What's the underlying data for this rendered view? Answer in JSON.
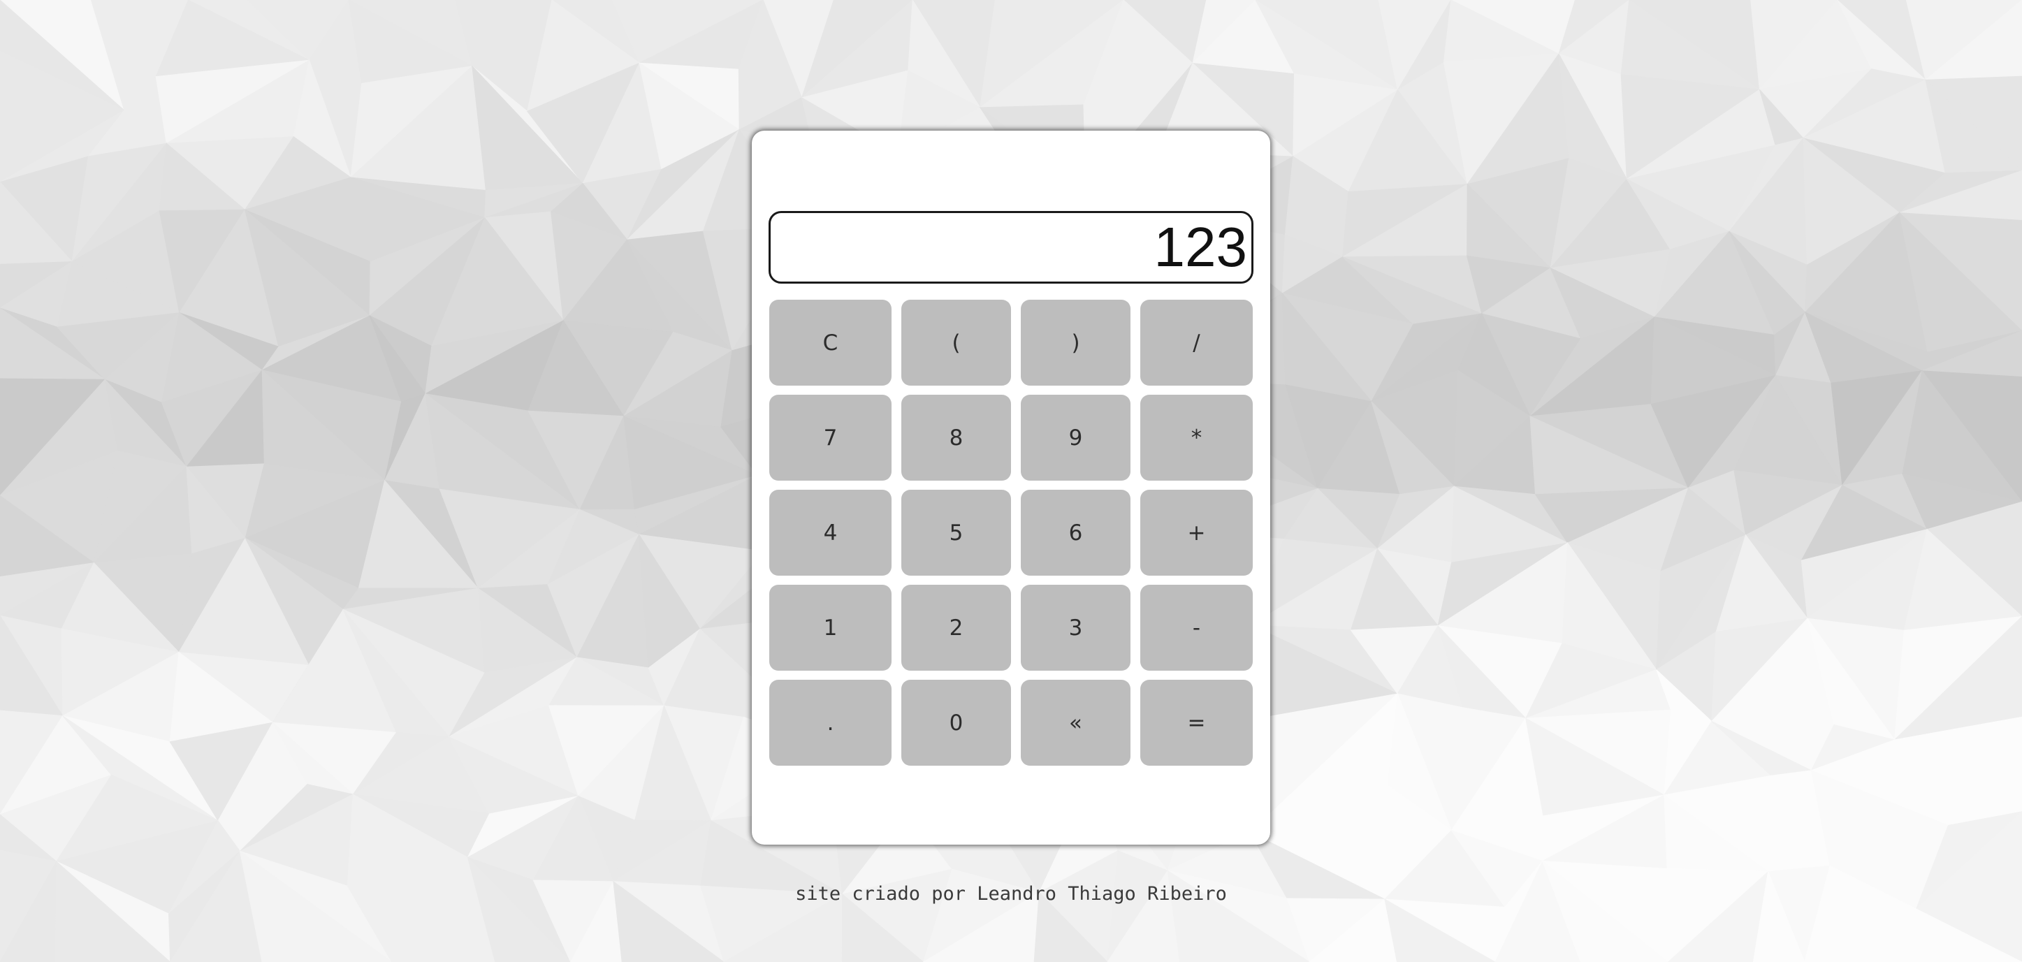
{
  "calculator": {
    "display_value": "123",
    "keys": [
      {
        "name": "clear-button",
        "label": "C"
      },
      {
        "name": "open-paren-button",
        "label": "("
      },
      {
        "name": "close-paren-button",
        "label": ")"
      },
      {
        "name": "divide-button",
        "label": "/"
      },
      {
        "name": "seven-button",
        "label": "7"
      },
      {
        "name": "eight-button",
        "label": "8"
      },
      {
        "name": "nine-button",
        "label": "9"
      },
      {
        "name": "multiply-button",
        "label": "*"
      },
      {
        "name": "four-button",
        "label": "4"
      },
      {
        "name": "five-button",
        "label": "5"
      },
      {
        "name": "six-button",
        "label": "6"
      },
      {
        "name": "plus-button",
        "label": "+"
      },
      {
        "name": "one-button",
        "label": "1"
      },
      {
        "name": "two-button",
        "label": "2"
      },
      {
        "name": "three-button",
        "label": "3"
      },
      {
        "name": "minus-button",
        "label": "-"
      },
      {
        "name": "decimal-button",
        "label": "."
      },
      {
        "name": "zero-button",
        "label": "0"
      },
      {
        "name": "backspace-button",
        "label": "«"
      },
      {
        "name": "equals-button",
        "label": "="
      }
    ]
  },
  "footer": {
    "credit": "site criado por Leandro Thiago Ribeiro"
  },
  "theme": {
    "key_color": "#bdbdbd",
    "panel_color": "#ffffff",
    "background_color": "#f1f1f1"
  }
}
